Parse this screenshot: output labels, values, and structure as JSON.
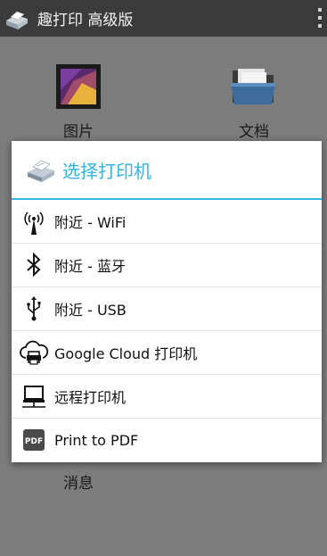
{
  "app": {
    "title": "趣打印 高级版"
  },
  "tiles": [
    {
      "label": "图片",
      "icon": "photo-icon"
    },
    {
      "label": "文档",
      "icon": "folder-icon"
    },
    {
      "label": "消息",
      "icon": "message-icon"
    }
  ],
  "dialog": {
    "title": "选择打印机",
    "icon": "printer-icon",
    "options": [
      {
        "label": "附近 - WiFi",
        "icon": "wifi-antenna-icon"
      },
      {
        "label": "附近 - 蓝牙",
        "icon": "bluetooth-icon"
      },
      {
        "label": "附近 - USB",
        "icon": "usb-icon"
      },
      {
        "label": "Google Cloud 打印机",
        "icon": "cloud-print-icon"
      },
      {
        "label": "远程打印机",
        "icon": "remote-computer-icon"
      },
      {
        "label": "Print to PDF",
        "icon": "pdf-icon"
      }
    ]
  },
  "colors": {
    "accent": "#33b5e5",
    "appbar": "#3b3b3b",
    "scrim": "#7a7a7a"
  }
}
